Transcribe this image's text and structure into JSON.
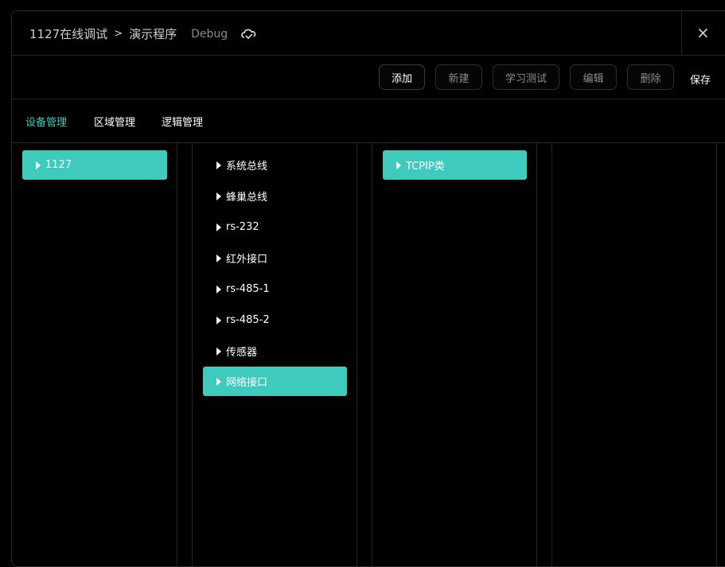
{
  "header": {
    "breadcrumb_root": "1127在线调试",
    "breadcrumb_sep": ">",
    "breadcrumb_current": "演示程序",
    "mode": "Debug",
    "close_label": "×"
  },
  "toolbar": {
    "add": "添加",
    "new": "新建",
    "learn_test": "学习测试",
    "edit": "编辑",
    "delete": "删除",
    "save": "保存"
  },
  "tabs": [
    {
      "label": "设备管理",
      "selected": true
    },
    {
      "label": "区域管理",
      "selected": false
    },
    {
      "label": "逻辑管理",
      "selected": false
    }
  ],
  "columns": {
    "col1": [
      {
        "label": "1127",
        "selected": true
      }
    ],
    "col2": [
      {
        "label": "系统总线",
        "selected": false
      },
      {
        "label": "蜂巢总线",
        "selected": false
      },
      {
        "label": "rs-232",
        "selected": false
      },
      {
        "label": "红外接口",
        "selected": false
      },
      {
        "label": "rs-485-1",
        "selected": false
      },
      {
        "label": "rs-485-2",
        "selected": false
      },
      {
        "label": "传感器",
        "selected": false
      },
      {
        "label": "网络接口",
        "selected": true
      }
    ],
    "col3": [
      {
        "label": "TCPIP类",
        "selected": true
      }
    ],
    "col4": []
  },
  "colors": {
    "accent": "#3ecbbd",
    "background": "#000000",
    "border": "#262626"
  }
}
